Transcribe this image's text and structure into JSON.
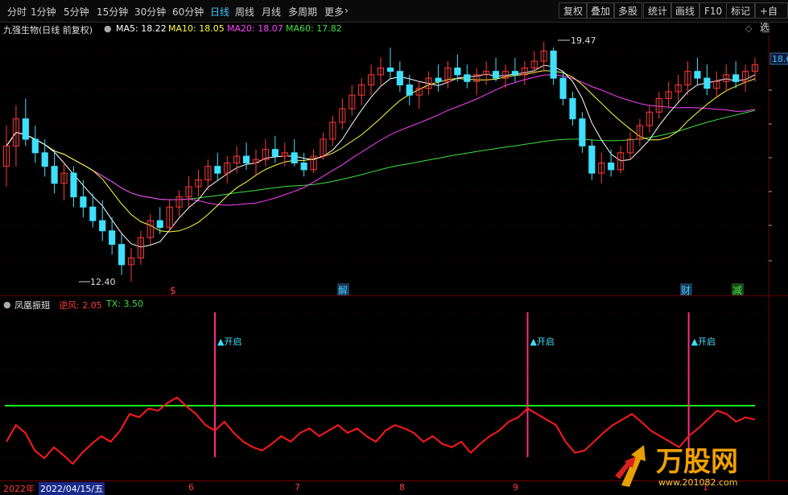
{
  "toolbar": {
    "tabs": [
      "分时",
      "1分钟",
      "5分钟",
      "15分钟",
      "30分钟",
      "60分钟",
      "日线",
      "周线",
      "月线",
      "多周期",
      "更多"
    ],
    "active_tab": "日线",
    "more_arrow": "›",
    "right_buttons": [
      "复权",
      "叠加",
      "多股",
      "统计",
      "画线",
      "F10",
      "标记",
      "+自选"
    ]
  },
  "stock": {
    "title": "九强生物(日线 前复权)",
    "ma5": "MA5: 18.22",
    "ma10": "MA10: 18.05",
    "ma20": "MA20: 18.07",
    "ma60": "MA60: 17.82",
    "high_label": "19.47",
    "low_label": "12.40",
    "price_tag": "18.6",
    "markers": [
      "$",
      "解",
      "财",
      "减"
    ]
  },
  "indicator": {
    "name": "凤凰振翅",
    "nifeng": "逆风: 2.05",
    "tx": "TX: 3.50",
    "signal_label": "开启"
  },
  "bottom": {
    "year": "2022年",
    "date": "2022/04/15/五",
    "months": [
      "6",
      "7",
      "8",
      "9",
      "1"
    ]
  },
  "watermark": {
    "brand": "万股网",
    "url": "www.201082.com"
  },
  "colors": {
    "up": "#ff3a3a",
    "down": "#3fe0ff",
    "ma5": "#ffffff",
    "ma10": "#ffff40",
    "ma20": "#ff40ff",
    "ma60": "#40e040",
    "signal": "#ff2a8a",
    "line": "#ff1a1a",
    "hline": "#1aff1a",
    "active": "#3fc6ff"
  },
  "chart_data": {
    "type": "candlestick",
    "ohlc": [
      [
        15.8,
        17.0,
        15.2,
        16.4
      ],
      [
        16.4,
        17.6,
        15.8,
        17.2
      ],
      [
        17.2,
        17.8,
        16.4,
        16.6
      ],
      [
        16.6,
        17.0,
        15.9,
        16.2
      ],
      [
        16.2,
        16.6,
        15.5,
        15.8
      ],
      [
        15.8,
        16.3,
        15.0,
        15.3
      ],
      [
        15.3,
        15.9,
        14.8,
        15.6
      ],
      [
        15.6,
        15.8,
        14.6,
        14.9
      ],
      [
        14.9,
        15.4,
        14.3,
        14.6
      ],
      [
        14.6,
        15.0,
        14.0,
        14.2
      ],
      [
        14.2,
        14.8,
        13.6,
        13.9
      ],
      [
        13.9,
        14.3,
        13.2,
        13.5
      ],
      [
        13.5,
        13.8,
        12.6,
        12.9
      ],
      [
        12.9,
        13.4,
        12.4,
        13.1
      ],
      [
        13.1,
        13.9,
        12.9,
        13.7
      ],
      [
        13.7,
        14.4,
        13.5,
        14.2
      ],
      [
        14.2,
        14.6,
        13.8,
        14.0
      ],
      [
        14.0,
        14.8,
        13.9,
        14.6
      ],
      [
        14.6,
        15.1,
        14.3,
        14.9
      ],
      [
        14.9,
        15.5,
        14.6,
        15.2
      ],
      [
        15.2,
        15.7,
        14.9,
        15.4
      ],
      [
        15.4,
        16.0,
        15.1,
        15.8
      ],
      [
        15.8,
        16.2,
        15.4,
        15.6
      ],
      [
        15.6,
        16.1,
        15.3,
        15.9
      ],
      [
        15.9,
        16.4,
        15.6,
        16.1
      ],
      [
        16.1,
        16.5,
        15.7,
        15.9
      ],
      [
        15.9,
        16.3,
        15.5,
        16.0
      ],
      [
        16.0,
        16.6,
        15.8,
        16.3
      ],
      [
        16.3,
        16.7,
        15.9,
        16.1
      ],
      [
        16.1,
        16.5,
        15.8,
        16.2
      ],
      [
        16.2,
        16.6,
        15.8,
        15.9
      ],
      [
        15.9,
        16.2,
        15.5,
        15.7
      ],
      [
        15.7,
        16.3,
        15.6,
        16.1
      ],
      [
        16.1,
        16.8,
        16.0,
        16.6
      ],
      [
        16.6,
        17.3,
        16.4,
        17.1
      ],
      [
        17.1,
        17.8,
        16.9,
        17.5
      ],
      [
        17.5,
        18.2,
        17.3,
        17.9
      ],
      [
        17.9,
        18.4,
        17.6,
        18.2
      ],
      [
        18.2,
        18.8,
        17.9,
        18.5
      ],
      [
        18.5,
        19.0,
        18.2,
        18.7
      ],
      [
        18.7,
        19.3,
        18.4,
        18.6
      ],
      [
        18.6,
        18.9,
        18.0,
        18.2
      ],
      [
        18.2,
        18.5,
        17.6,
        17.9
      ],
      [
        17.9,
        18.3,
        17.5,
        18.1
      ],
      [
        18.1,
        18.6,
        17.9,
        18.4
      ],
      [
        18.4,
        18.8,
        18.0,
        18.3
      ],
      [
        18.3,
        18.9,
        18.1,
        18.7
      ],
      [
        18.7,
        19.1,
        18.3,
        18.5
      ],
      [
        18.5,
        18.8,
        18.1,
        18.3
      ],
      [
        18.3,
        18.7,
        17.9,
        18.5
      ],
      [
        18.5,
        18.9,
        18.2,
        18.6
      ],
      [
        18.6,
        19.0,
        18.3,
        18.4
      ],
      [
        18.4,
        18.8,
        18.1,
        18.6
      ],
      [
        18.6,
        19.0,
        18.3,
        18.5
      ],
      [
        18.5,
        18.9,
        18.2,
        18.7
      ],
      [
        18.7,
        19.2,
        18.5,
        18.9
      ],
      [
        18.9,
        19.47,
        18.6,
        19.2
      ],
      [
        19.2,
        19.3,
        18.2,
        18.4
      ],
      [
        18.4,
        18.6,
        17.6,
        17.8
      ],
      [
        17.8,
        18.0,
        17.0,
        17.2
      ],
      [
        17.2,
        17.4,
        16.2,
        16.4
      ],
      [
        16.4,
        16.6,
        15.4,
        15.6
      ],
      [
        15.6,
        16.2,
        15.3,
        15.9
      ],
      [
        15.9,
        16.3,
        15.5,
        15.7
      ],
      [
        15.7,
        16.4,
        15.6,
        16.2
      ],
      [
        16.2,
        16.8,
        16.0,
        16.6
      ],
      [
        16.6,
        17.2,
        16.4,
        17.0
      ],
      [
        17.0,
        17.6,
        16.8,
        17.4
      ],
      [
        17.4,
        18.0,
        17.2,
        17.8
      ],
      [
        17.8,
        18.3,
        17.5,
        18.0
      ],
      [
        18.0,
        18.5,
        17.7,
        18.2
      ],
      [
        18.2,
        18.9,
        17.9,
        18.6
      ],
      [
        18.6,
        19.0,
        18.2,
        18.4
      ],
      [
        18.4,
        18.8,
        17.9,
        18.1
      ],
      [
        18.1,
        18.6,
        17.8,
        18.3
      ],
      [
        18.3,
        18.8,
        18.0,
        18.5
      ],
      [
        18.5,
        18.9,
        18.1,
        18.3
      ],
      [
        18.3,
        18.8,
        18.0,
        18.6
      ],
      [
        18.6,
        19.0,
        18.3,
        18.8
      ]
    ],
    "ylim": [
      12.0,
      20.0
    ],
    "indicator_series": [
      30,
      45,
      38,
      22,
      15,
      25,
      18,
      10,
      20,
      28,
      35,
      30,
      40,
      55,
      52,
      60,
      58,
      65,
      70,
      62,
      55,
      45,
      40,
      48,
      38,
      30,
      25,
      22,
      28,
      35,
      30,
      38,
      42,
      35,
      40,
      45,
      38,
      42,
      35,
      30,
      40,
      45,
      42,
      38,
      30,
      35,
      28,
      25,
      30,
      20,
      28,
      35,
      40,
      48,
      52,
      60,
      55,
      50,
      45,
      30,
      20,
      22,
      30,
      38,
      45,
      50,
      55,
      48,
      40,
      35,
      30,
      25,
      35,
      42,
      50,
      58,
      55,
      48,
      52,
      50
    ],
    "signals": [
      22,
      55,
      72
    ]
  }
}
